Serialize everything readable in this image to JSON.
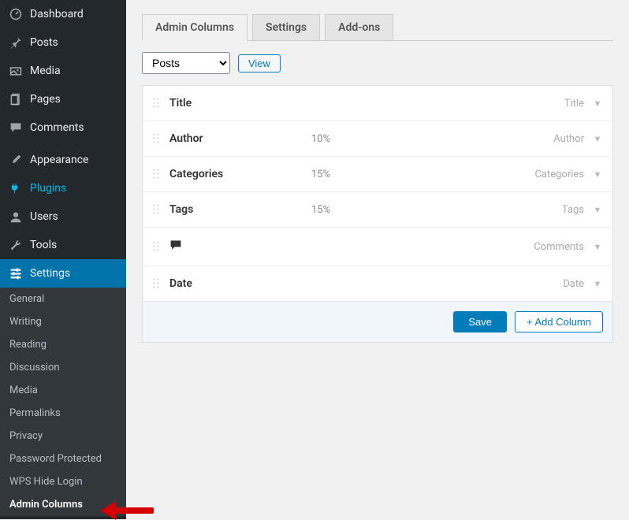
{
  "sidebar": {
    "top": [
      {
        "icon": "dashboard",
        "label": "Dashboard"
      },
      {
        "icon": "pin",
        "label": "Posts"
      },
      {
        "icon": "media",
        "label": "Media"
      },
      {
        "icon": "page",
        "label": "Pages"
      },
      {
        "icon": "comments",
        "label": "Comments"
      }
    ],
    "mid": [
      {
        "icon": "brush",
        "label": "Appearance"
      },
      {
        "icon": "plug",
        "label": "Plugins",
        "highlight": true
      },
      {
        "icon": "user",
        "label": "Users"
      },
      {
        "icon": "wrench",
        "label": "Tools"
      },
      {
        "icon": "sliders",
        "label": "Settings",
        "active": true
      }
    ],
    "sub": [
      "General",
      "Writing",
      "Reading",
      "Discussion",
      "Media",
      "Permalinks",
      "Privacy",
      "Password Protected",
      "WPS Hide Login",
      "Admin Columns"
    ],
    "sub_active": "Admin Columns"
  },
  "tabs": [
    "Admin Columns",
    "Settings",
    "Add-ons"
  ],
  "tabs_active": "Admin Columns",
  "post_type_select": "Posts",
  "view_label": "View",
  "columns": [
    {
      "name": "Title",
      "width": "",
      "type": "Title"
    },
    {
      "name": "Author",
      "width": "10%",
      "type": "Author"
    },
    {
      "name": "Categories",
      "width": "15%",
      "type": "Categories"
    },
    {
      "name": "Tags",
      "width": "15%",
      "type": "Tags"
    },
    {
      "name_icon": "comment",
      "width": "",
      "type": "Comments"
    },
    {
      "name": "Date",
      "width": "",
      "type": "Date"
    }
  ],
  "buttons": {
    "save": "Save",
    "add": "+ Add Column"
  }
}
